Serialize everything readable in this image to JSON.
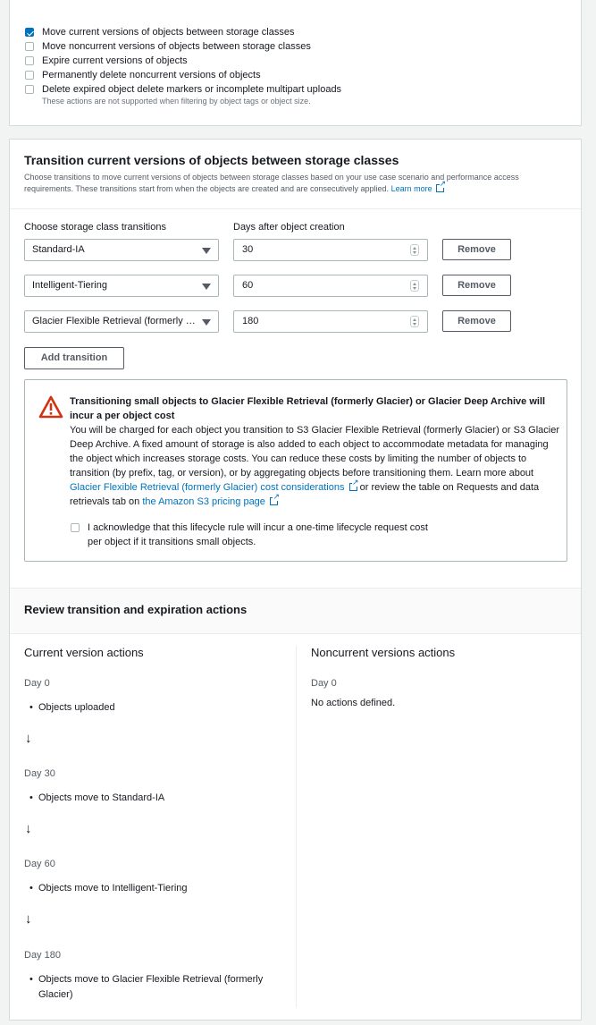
{
  "actions": {
    "options": [
      {
        "label": "Move current versions of objects between storage classes",
        "checked": true
      },
      {
        "label": "Move noncurrent versions of objects between storage classes",
        "checked": false
      },
      {
        "label": "Expire current versions of objects",
        "checked": false
      },
      {
        "label": "Permanently delete noncurrent versions of objects",
        "checked": false
      },
      {
        "label": "Delete expired object delete markers or incomplete multipart uploads",
        "checked": false
      }
    ],
    "note": "These actions are not supported when filtering by object tags or object size."
  },
  "transition_section": {
    "title": "Transition current versions of objects between storage classes",
    "description": "Choose transitions to move current versions of objects between storage classes based on your use case scenario and performance access requirements. These transitions start from when the objects are created and are consecutively applied.",
    "learn_more": "Learn more",
    "class_label": "Choose storage class transitions",
    "days_label": "Days after object creation",
    "rows": [
      {
        "storage_class": "Standard-IA",
        "days": "30",
        "remove": "Remove"
      },
      {
        "storage_class": "Intelligent-Tiering",
        "days": "60",
        "remove": "Remove"
      },
      {
        "storage_class": "Glacier Flexible Retrieval (formerly Glacier)",
        "days": "180",
        "remove": "Remove"
      }
    ],
    "add_button": "Add transition"
  },
  "warning": {
    "title": "Transitioning small objects to Glacier Flexible Retrieval (formerly Glacier) or Glacier Deep Archive will incur a per object cost",
    "body_1": "You will be charged for each object you transition to S3 Glacier Flexible Retrieval (formerly Glacier) or S3 Glacier Deep Archive. A fixed amount of storage is also added to each object to accommodate metadata for managing the object which increases storage costs. You can reduce these costs by limiting the number of objects to transition (by prefix, tag, or version), or by aggregating objects before transitioning them. Learn more about ",
    "link_1": "Glacier Flexible Retrieval (formerly Glacier) cost considerations",
    "body_2": " or review the table on Requests and data retrievals tab on ",
    "link_2": "the Amazon S3 pricing page",
    "acknowledge": "I acknowledge that this lifecycle rule will incur a one-time lifecycle request cost per object if it transitions small objects.",
    "acknowledged": false
  },
  "review": {
    "title": "Review transition and expiration actions",
    "current_title": "Current version actions",
    "noncurrent_title": "Noncurrent versions actions",
    "current_steps": [
      {
        "day": "Day 0",
        "action": "Objects uploaded"
      },
      {
        "day": "Day 30",
        "action": "Objects move to Standard-IA"
      },
      {
        "day": "Day 60",
        "action": "Objects move to Intelligent-Tiering"
      },
      {
        "day": "Day 180",
        "action": "Objects move to Glacier Flexible Retrieval (formerly Glacier)"
      }
    ],
    "noncurrent_day": "Day 0",
    "noncurrent_text": "No actions defined."
  },
  "colors": {
    "accent": "#0073bb",
    "warning": "#d13212"
  },
  "icons": {
    "warning": "warning-icon",
    "external_link": "external-link-icon",
    "arrow": "arrow-down-icon"
  }
}
